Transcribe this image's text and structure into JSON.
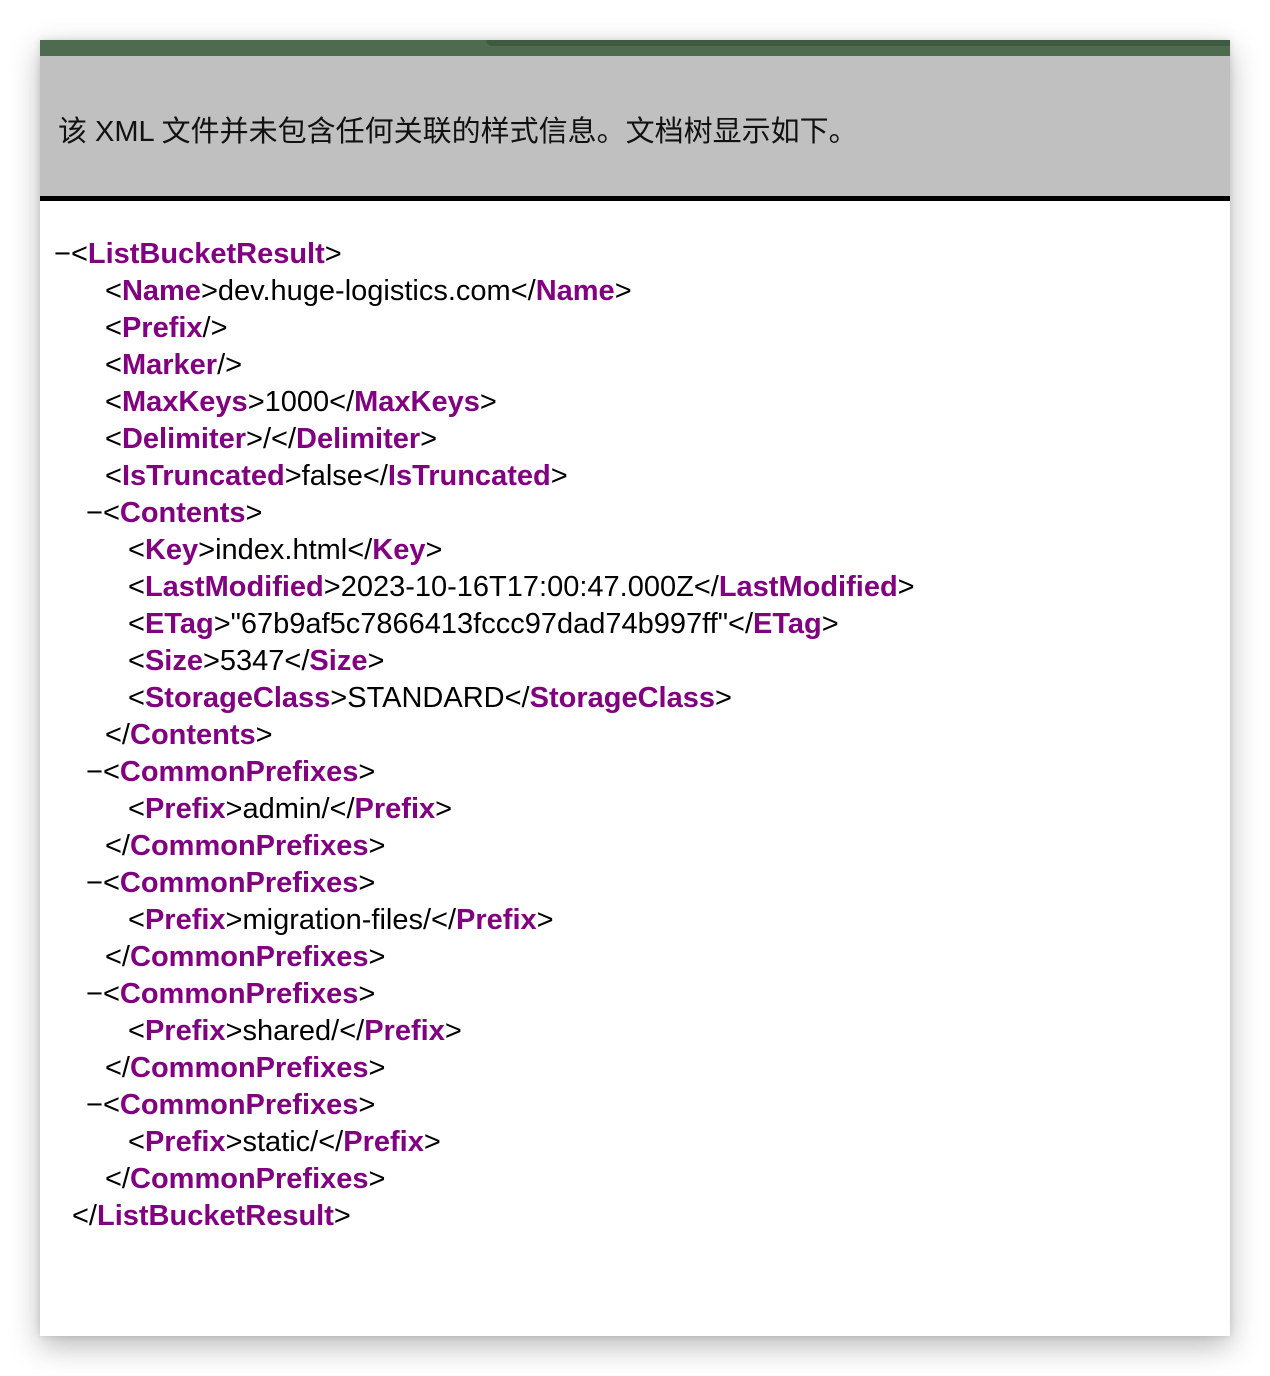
{
  "colors": {
    "tag_name": "#800080",
    "notice_bg": "#c0c0c0",
    "toolbar_green": "#4e6b50"
  },
  "notice": {
    "text": "该 XML 文件并未包含任何关联的样式信息。文档树显示如下。"
  },
  "xml_tree": {
    "lines": [
      {
        "indent": 0,
        "toggle": "−",
        "open": "ListBucketResult"
      },
      {
        "indent": 1,
        "open": "Name",
        "text": "dev.huge-logistics.com",
        "close": "Name"
      },
      {
        "indent": 1,
        "selfclose": "Prefix"
      },
      {
        "indent": 1,
        "selfclose": "Marker"
      },
      {
        "indent": 1,
        "open": "MaxKeys",
        "text": "1000",
        "close": "MaxKeys"
      },
      {
        "indent": 1,
        "open": "Delimiter",
        "text": "/",
        "close": "Delimiter"
      },
      {
        "indent": 1,
        "open": "IsTruncated",
        "text": "false",
        "close": "IsTruncated"
      },
      {
        "indent": 1,
        "toggle": "−",
        "open": "Contents"
      },
      {
        "indent": 2,
        "open": "Key",
        "text": "index.html",
        "close": "Key"
      },
      {
        "indent": 2,
        "open": "LastModified",
        "text": "2023-10-16T17:00:47.000Z",
        "close": "LastModified"
      },
      {
        "indent": 2,
        "open": "ETag",
        "text": "\"67b9af5c7866413fccc97dad74b997ff\"",
        "close": "ETag"
      },
      {
        "indent": 2,
        "open": "Size",
        "text": "5347",
        "close": "Size"
      },
      {
        "indent": 2,
        "open": "StorageClass",
        "text": "STANDARD",
        "close": "StorageClass"
      },
      {
        "indent": 1,
        "closeonly": "Contents"
      },
      {
        "indent": 1,
        "toggle": "−",
        "open": "CommonPrefixes"
      },
      {
        "indent": 2,
        "open": "Prefix",
        "text": "admin/",
        "close": "Prefix"
      },
      {
        "indent": 1,
        "closeonly": "CommonPrefixes"
      },
      {
        "indent": 1,
        "toggle": "−",
        "open": "CommonPrefixes"
      },
      {
        "indent": 2,
        "open": "Prefix",
        "text": "migration-files/",
        "close": "Prefix"
      },
      {
        "indent": 1,
        "closeonly": "CommonPrefixes"
      },
      {
        "indent": 1,
        "toggle": "−",
        "open": "CommonPrefixes"
      },
      {
        "indent": 2,
        "open": "Prefix",
        "text": "shared/",
        "close": "Prefix"
      },
      {
        "indent": 1,
        "closeonly": "CommonPrefixes"
      },
      {
        "indent": 1,
        "toggle": "−",
        "open": "CommonPrefixes"
      },
      {
        "indent": 2,
        "open": "Prefix",
        "text": "static/",
        "close": "Prefix"
      },
      {
        "indent": 1,
        "closeonly": "CommonPrefixes"
      },
      {
        "indent": 0,
        "closeonly": "ListBucketResult"
      }
    ]
  }
}
